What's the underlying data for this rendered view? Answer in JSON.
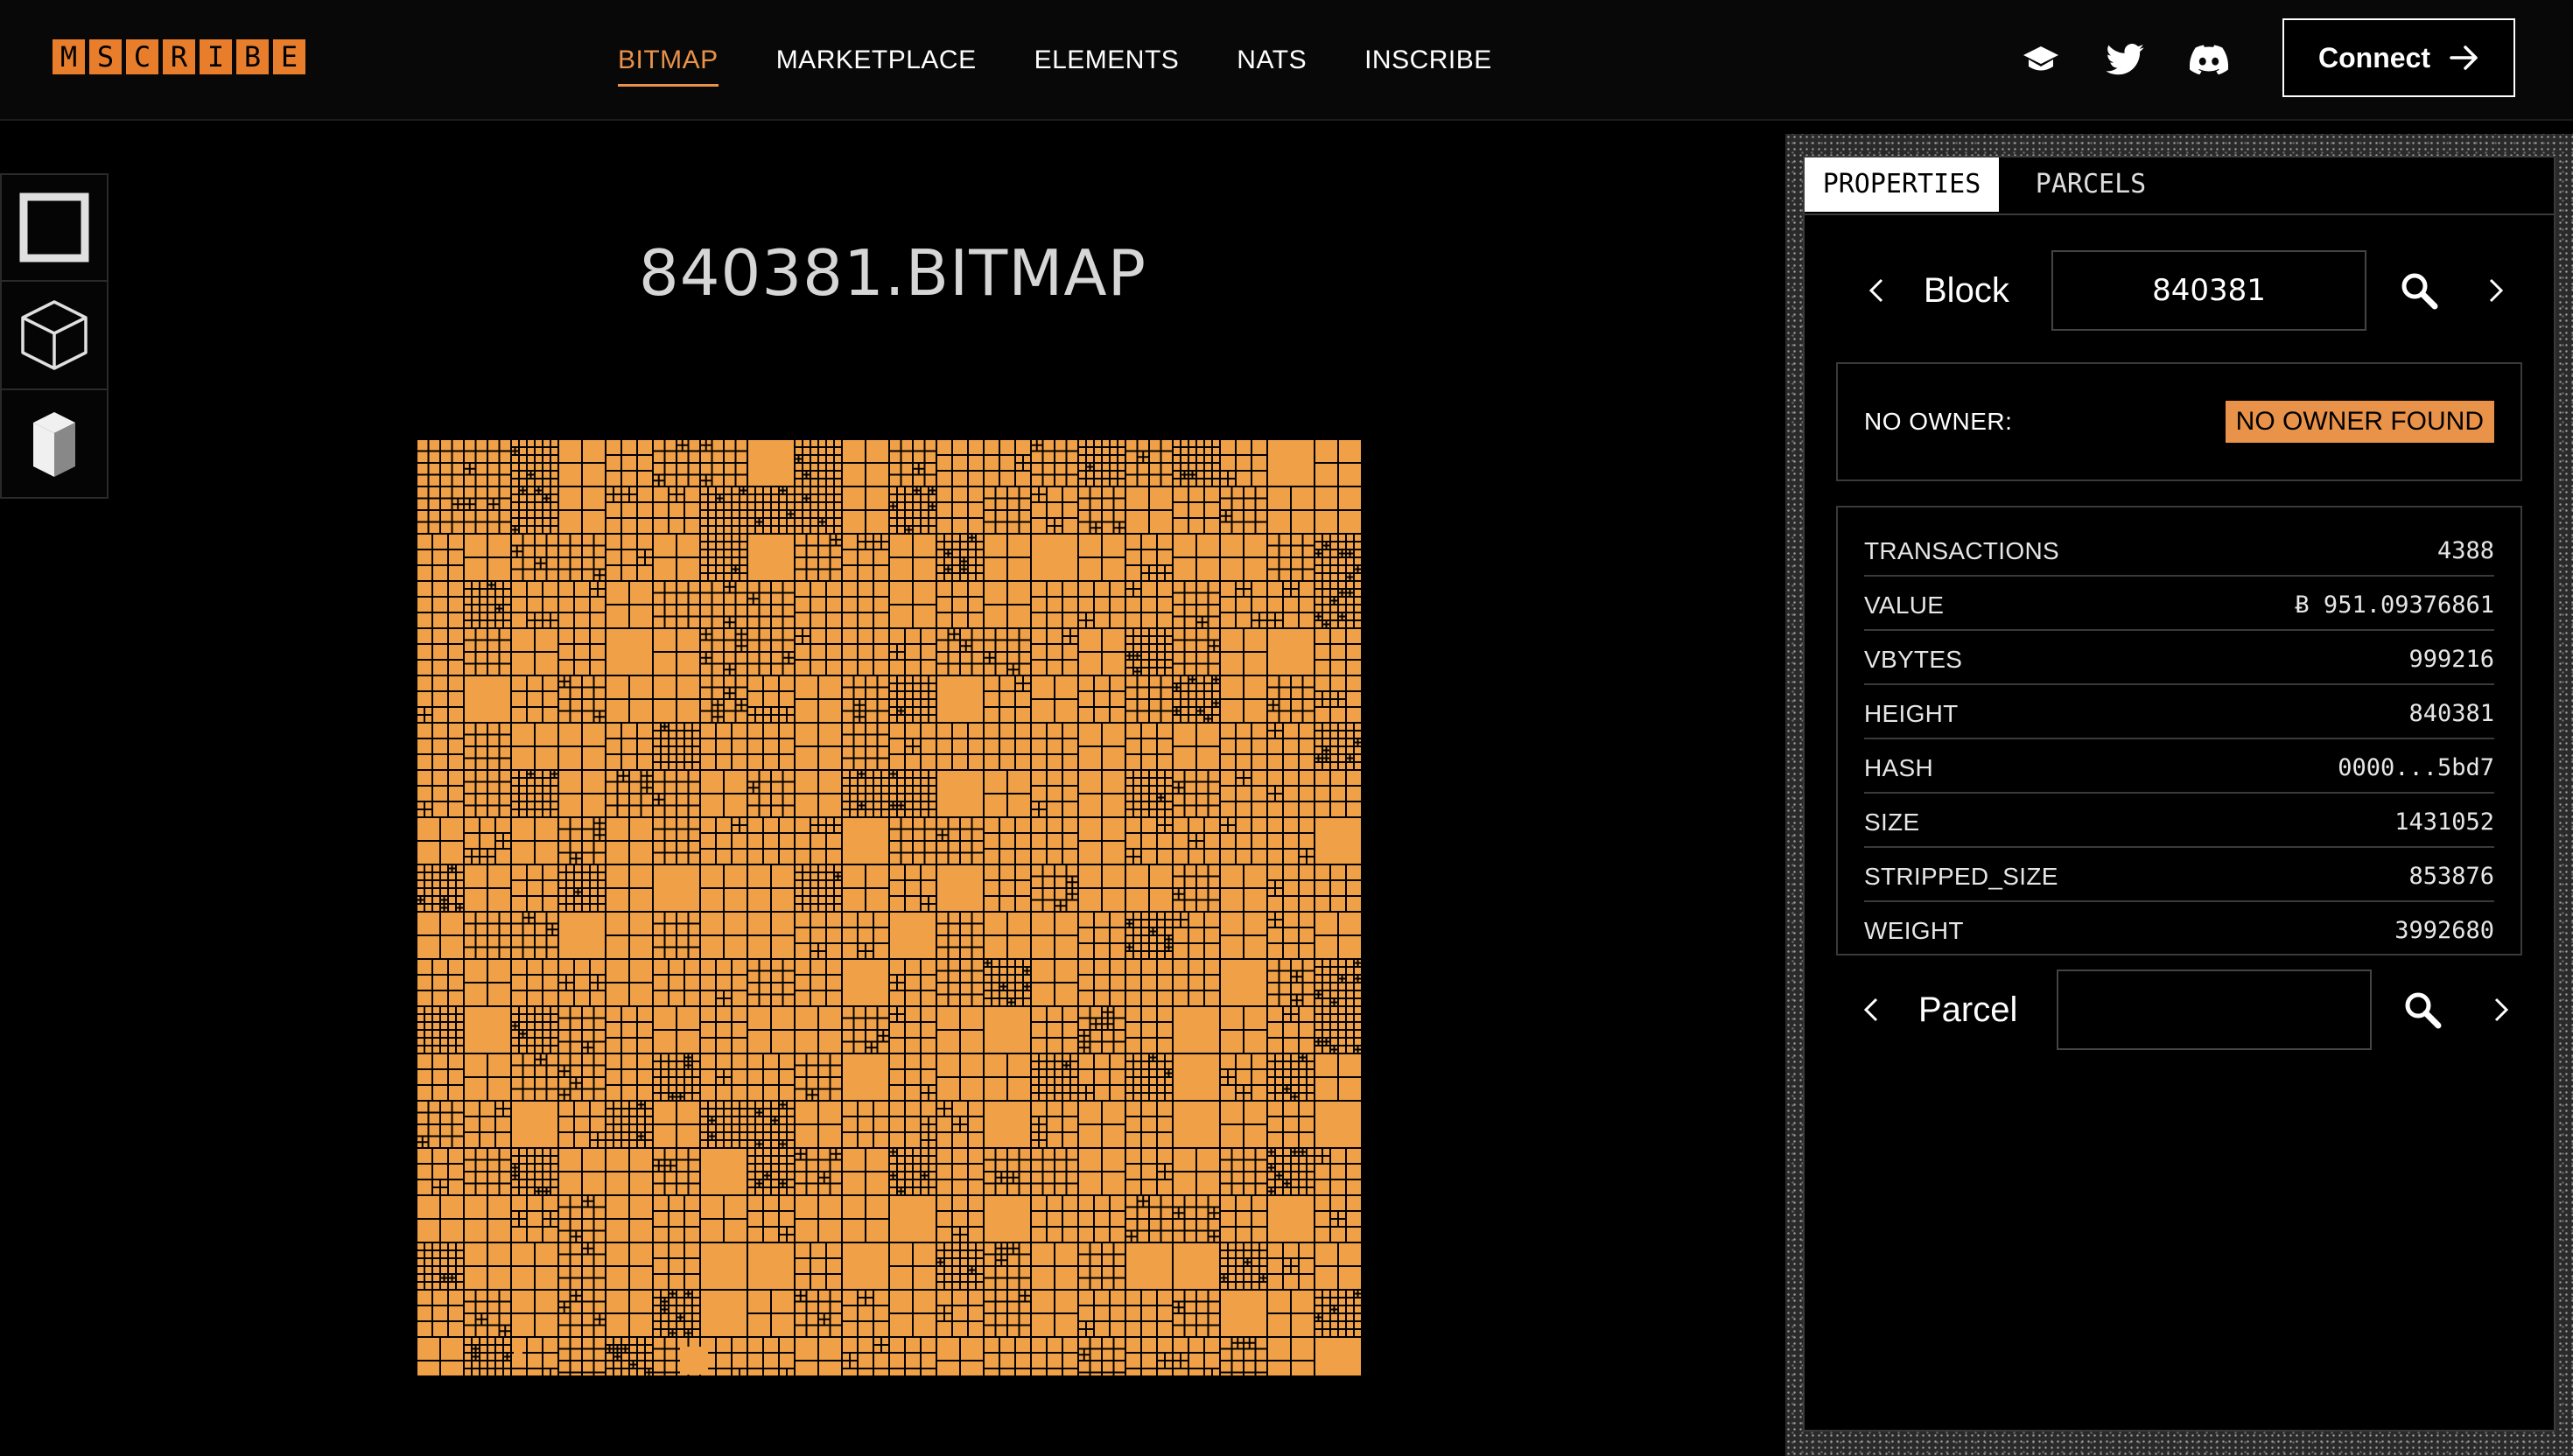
{
  "brand": {
    "letters": [
      "M",
      "S",
      "C",
      "R",
      "I",
      "B",
      "E"
    ],
    "accent": "#e87d2c"
  },
  "nav": {
    "items": [
      {
        "label": "BITMAP",
        "active": true
      },
      {
        "label": "MARKETPLACE",
        "active": false
      },
      {
        "label": "ELEMENTS",
        "active": false
      },
      {
        "label": "NATS",
        "active": false
      },
      {
        "label": "INSCRIBE",
        "active": false
      }
    ]
  },
  "socials": [
    "docs-icon",
    "twitter-icon",
    "discord-icon"
  ],
  "connect": {
    "label": "Connect"
  },
  "tools": [
    "square-view-icon",
    "cube-view-icon",
    "building-view-icon"
  ],
  "title": "840381.BITMAP",
  "map": {
    "fill_color": "#f0a046"
  },
  "panel": {
    "tabs": [
      {
        "label": "PROPERTIES",
        "active": true
      },
      {
        "label": "PARCELS",
        "active": false
      }
    ],
    "block": {
      "label": "Block",
      "value": "840381"
    },
    "owner": {
      "label": "NO OWNER:",
      "badge": "NO OWNER FOUND"
    },
    "stats": [
      {
        "key": "TRANSACTIONS",
        "value": "4388"
      },
      {
        "key": "VALUE",
        "value": "Ƀ 951.09376861"
      },
      {
        "key": "VBYTES",
        "value": "999216"
      },
      {
        "key": "HEIGHT",
        "value": "840381"
      },
      {
        "key": "HASH",
        "value": "0000...5bd7"
      },
      {
        "key": "SIZE",
        "value": "1431052"
      },
      {
        "key": "STRIPPED_SIZE",
        "value": "853876"
      },
      {
        "key": "WEIGHT",
        "value": "3992680"
      }
    ],
    "parcel": {
      "label": "Parcel",
      "value": ""
    }
  }
}
